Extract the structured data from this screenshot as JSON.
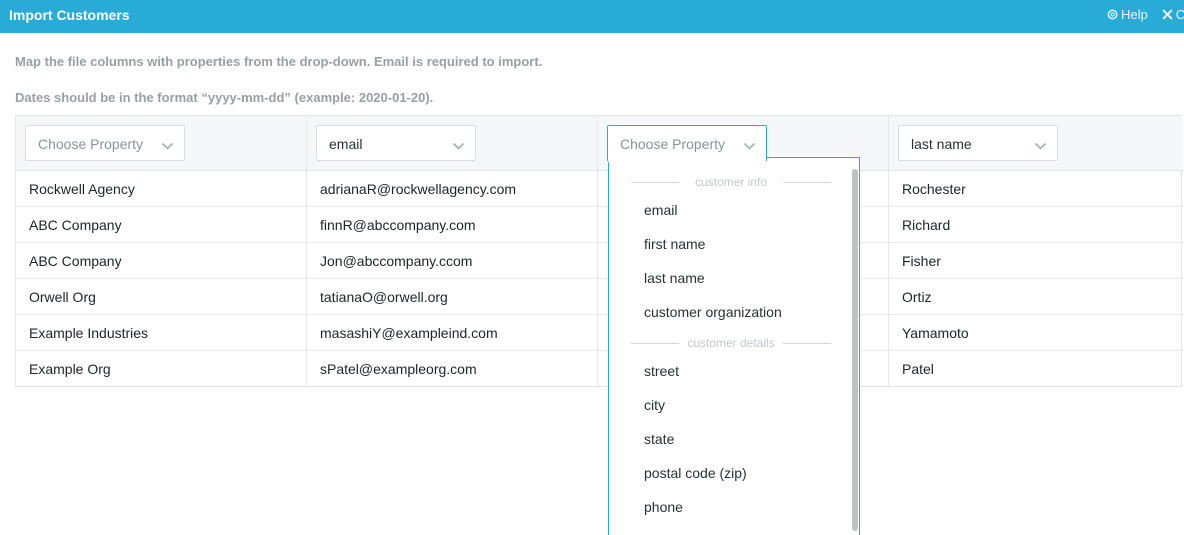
{
  "window": {
    "title": "Import Customers",
    "help_label": "Help",
    "close_label": "Cl"
  },
  "info": {
    "line1": "Map the file columns with properties from the drop-down. Email is required to import.",
    "line2": "Dates should be in the format “yyyy-mm-dd” (example: 2020-01-20)."
  },
  "columns": [
    {
      "selected": "Choose Property",
      "is_placeholder": true,
      "cells": [
        "Rockwell Agency",
        "ABC Company",
        "ABC Company",
        "Orwell Org",
        "Example Industries",
        "Example Org"
      ]
    },
    {
      "selected": "email",
      "is_placeholder": false,
      "cells": [
        "adrianaR@rockwellagency.com",
        "finnR@abccompany.com",
        "Jon@abccompany.ccom",
        "tatianaO@orwell.org",
        "masashiY@exampleind.com",
        "sPatel@exampleorg.com"
      ]
    },
    {
      "selected": "Choose Property",
      "is_placeholder": true,
      "open": true,
      "cells": [
        "",
        "",
        "",
        "",
        "",
        ""
      ]
    },
    {
      "selected": "last name",
      "is_placeholder": false,
      "cells": [
        "Rochester",
        "Richard",
        "Fisher",
        "Ortiz",
        "Yamamoto",
        "Patel"
      ]
    }
  ],
  "dropdown": {
    "groups": [
      {
        "label": "customer info",
        "items": [
          "email",
          "first name",
          "last name",
          "customer organization"
        ]
      },
      {
        "label": "customer details",
        "items": [
          "street",
          "city",
          "state",
          "postal code (zip)",
          "phone"
        ]
      }
    ]
  },
  "colors": {
    "accent": "#29abd8",
    "header_bg": "#f5f7f9",
    "muted_text": "#9a9ea3"
  },
  "icons": {
    "help": "lifebuoy-icon",
    "close": "close-icon",
    "select_arrow": "chevron-down-icon"
  }
}
